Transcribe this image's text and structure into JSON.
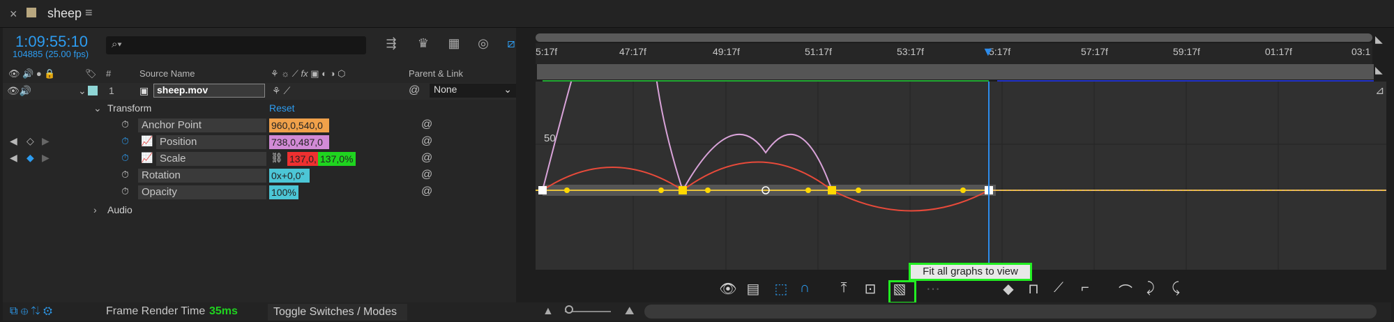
{
  "tab": {
    "close": "×",
    "title": "sheep",
    "menu": "≡"
  },
  "timecode": "1:09:55:10",
  "fps": "104885 (25.00 fps)",
  "search": {
    "placeholder": "",
    "icon": "search-icon"
  },
  "header": {
    "source_name": "Source Name",
    "num": "#",
    "parent_link": "Parent & Link",
    "fx": "fx"
  },
  "layer": {
    "num": "1",
    "name": "sheep.mov",
    "parent": "None"
  },
  "transform": {
    "label": "Transform",
    "reset": "Reset"
  },
  "properties": [
    {
      "name": "Anchor Point",
      "value": "960,0,540,0",
      "color": "#f0a14a"
    },
    {
      "name": "Position",
      "value": "738,0,487,0",
      "color": "#d28ad6"
    },
    {
      "name": "Scale",
      "value_a": "137,0,",
      "value_b": "137,0%",
      "color_a": "#ee3030",
      "color_b": "#1fd41f"
    },
    {
      "name": "Rotation",
      "value": "0x+0,0°",
      "color": "#4cc6d6"
    },
    {
      "name": "Opacity",
      "value": "100%",
      "color": "#4cc6d6"
    }
  ],
  "audio": {
    "label": "Audio"
  },
  "ruler_ticks": [
    "5:17f",
    "47:17f",
    "49:17f",
    "51:17f",
    "53:17f",
    "5:17f",
    "57:17f",
    "59:17f",
    "01:17f",
    "03:1"
  ],
  "graph": {
    "y_label": "50"
  },
  "tooltip": "Fit all graphs to view",
  "status": {
    "frame_render_label": "Frame Render Time",
    "frame_render_value": "35ms",
    "toggle": "Toggle Switches / Modes"
  }
}
